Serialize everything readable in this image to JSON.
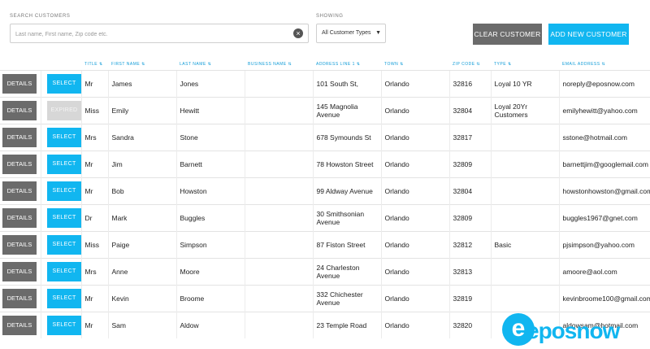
{
  "search": {
    "label": "SEARCH CUSTOMERS",
    "placeholder": "Last name, First name, Zip code etc."
  },
  "showing": {
    "label": "SHOWING",
    "selected": "All Customer Types"
  },
  "buttons": {
    "clear": "CLEAR CUSTOMER",
    "add": "ADD NEW CUSTOMER"
  },
  "columns": [
    "TITLE",
    "FIRST NAME",
    "LAST NAME",
    "BUSINESS NAME",
    "ADDRESS LINE 1",
    "TOWN",
    "ZIP CODE",
    "TYPE",
    "EMAIL ADDRESS"
  ],
  "row_buttons": {
    "details": "DETAILS",
    "select": "SELECT",
    "expired": "EXPIRED"
  },
  "rows": [
    {
      "status": "select",
      "title": "Mr",
      "first": "James",
      "last": "Jones",
      "business": "",
      "address": "101 South St,",
      "town": "Orlando",
      "zip": "32816",
      "type": "Loyal 10 YR",
      "email": "noreply@eposnow.com"
    },
    {
      "status": "expired",
      "title": "Miss",
      "first": "Emily",
      "last": "Hewitt",
      "business": "",
      "address": "145 Magnolia Avenue",
      "town": "Orlando",
      "zip": "32804",
      "type": "Loyal 20Yr Customers",
      "email": "emilyhewitt@yahoo.com"
    },
    {
      "status": "select",
      "title": "Mrs",
      "first": "Sandra",
      "last": "Stone",
      "business": "",
      "address": "678 Symounds St",
      "town": "Orlando",
      "zip": "32817",
      "type": "",
      "email": "sstone@hotmail.com"
    },
    {
      "status": "select",
      "title": "Mr",
      "first": "Jim",
      "last": "Barnett",
      "business": "",
      "address": "78 Howston Street",
      "town": "Orlando",
      "zip": "32809",
      "type": "",
      "email": "barnettjim@googlemail.com"
    },
    {
      "status": "select",
      "title": "Mr",
      "first": "Bob",
      "last": "Howston",
      "business": "",
      "address": "99 Aldway Avenue",
      "town": "Orlando",
      "zip": "32804",
      "type": "",
      "email": "howstonhowston@gmail.com"
    },
    {
      "status": "select",
      "title": "Dr",
      "first": "Mark",
      "last": "Buggles",
      "business": "",
      "address": "30 Smithsonian Avenue",
      "town": "Orlando",
      "zip": "32809",
      "type": "",
      "email": "buggles1967@gnet.com"
    },
    {
      "status": "select",
      "title": "Miss",
      "first": "Paige",
      "last": "Simpson",
      "business": "",
      "address": "87 Fiston Street",
      "town": "Orlando",
      "zip": "32812",
      "type": "Basic",
      "email": "pjsimpson@yahoo.com"
    },
    {
      "status": "select",
      "title": "Mrs",
      "first": "Anne",
      "last": "Moore",
      "business": "",
      "address": "24 Charleston Avenue",
      "town": "Orlando",
      "zip": "32813",
      "type": "",
      "email": "amoore@aol.com"
    },
    {
      "status": "select",
      "title": "Mr",
      "first": "Kevin",
      "last": "Broome",
      "business": "",
      "address": "332 Chichester Avenue",
      "town": "Orlando",
      "zip": "32819",
      "type": "",
      "email": "kevinbroome100@gmail.com"
    },
    {
      "status": "select",
      "title": "Mr",
      "first": "Sam",
      "last": "Aldow",
      "business": "",
      "address": "23 Temple Road",
      "town": "Orlando",
      "zip": "32820",
      "type": "",
      "email": "aldowsam@hotmail.com"
    }
  ],
  "logo": {
    "text": "eposnow"
  },
  "colors": {
    "accent": "#11b6f0",
    "dark_button": "#6b6b6b",
    "header_text": "#0f9bd7"
  }
}
